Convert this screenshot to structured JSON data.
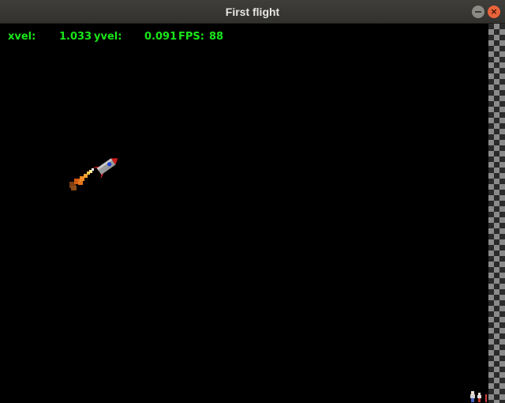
{
  "window": {
    "title": "First flight",
    "close_glyph": "×"
  },
  "hud": {
    "xvel_label": "xvel:",
    "xvel_value": "1.033",
    "yvel_label": "yvel:",
    "yvel_value": "0.091",
    "fps_label": "FPS:",
    "fps_value": "88",
    "color": "#19e619"
  },
  "scene": {
    "background": "#000000",
    "finish_line": "checkered-strip",
    "rocket_icon": "rocket-icon",
    "flame_icon": "exhaust-flame-icon",
    "figures_icon": "people-icon"
  }
}
